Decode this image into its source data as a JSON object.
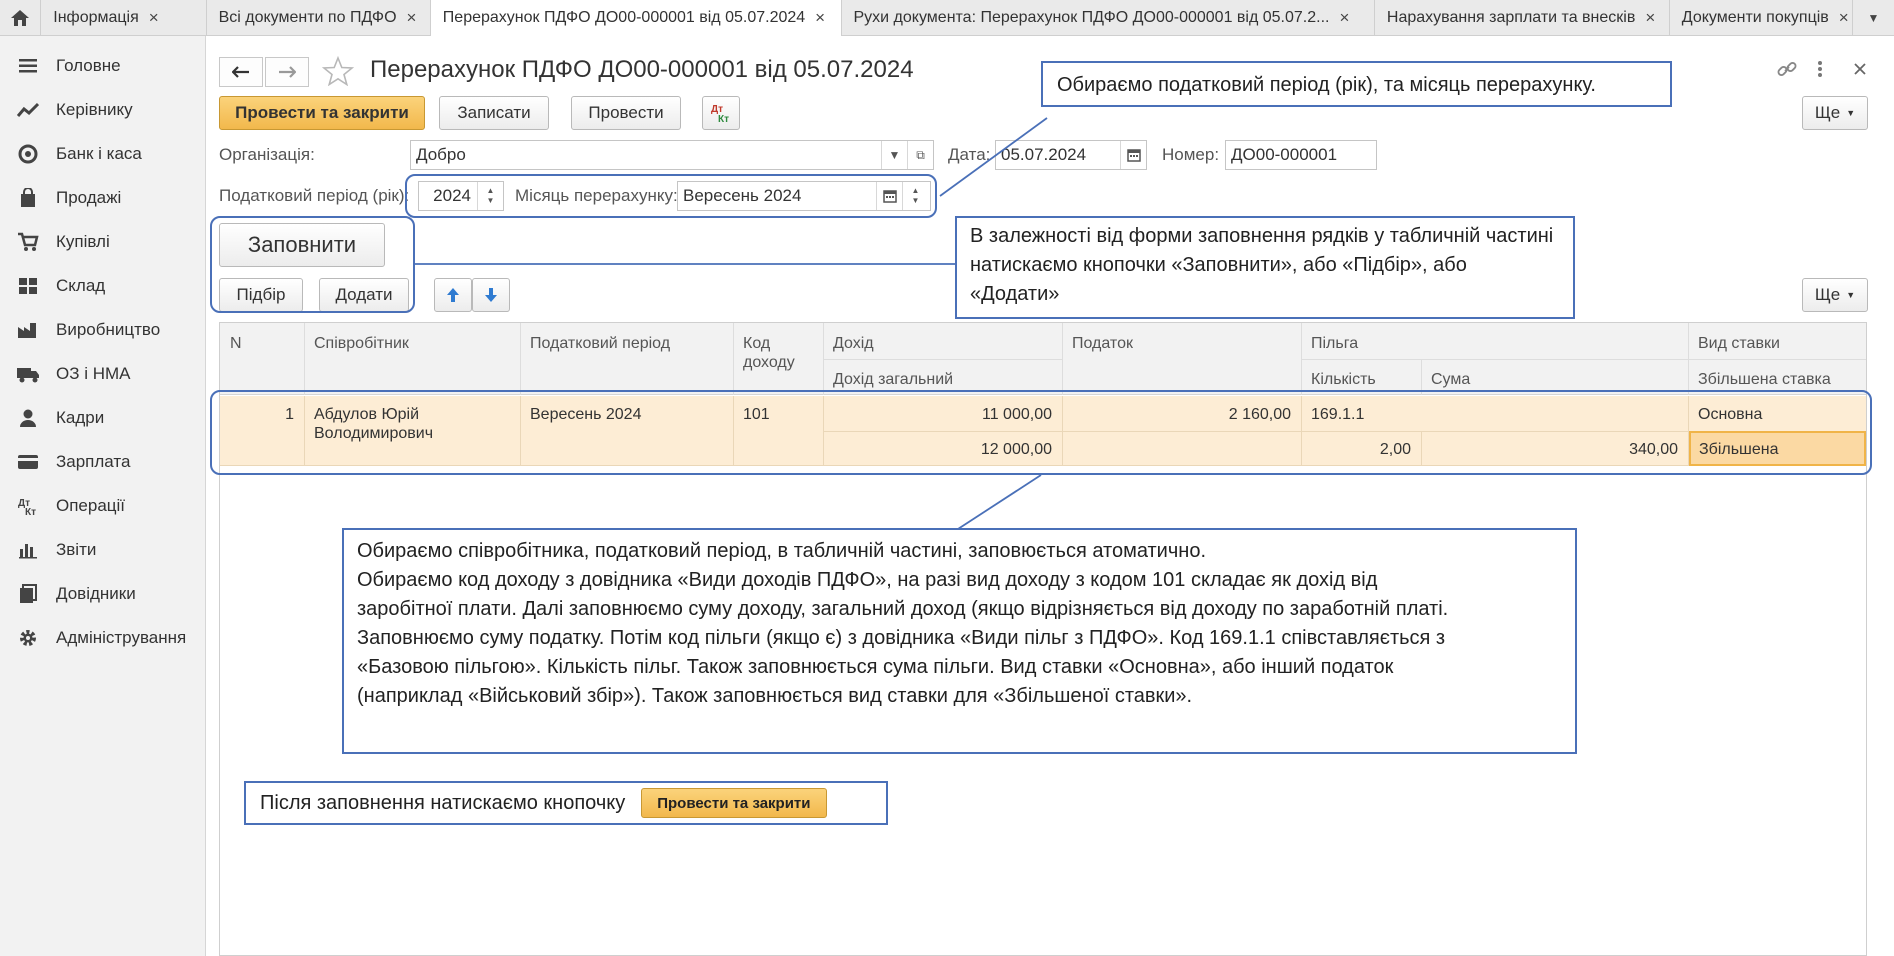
{
  "tabs": [
    {
      "label": "Інформація"
    },
    {
      "label": "Всі документи по ПДФО"
    },
    {
      "label": "Перерахунок ПДФО ДО00-000001 від 05.07.2024"
    },
    {
      "label": "Рухи документа: Перерахунок ПДФО ДО00-000001 від 05.07.2..."
    },
    {
      "label": "Нарахування зарплати та внесків"
    },
    {
      "label": "Документи покупців"
    }
  ],
  "sidebar": {
    "items": [
      {
        "label": "Головне",
        "icon": "menu-icon"
      },
      {
        "label": "Керівнику",
        "icon": "trend-icon"
      },
      {
        "label": "Банк і каса",
        "icon": "coins-icon"
      },
      {
        "label": "Продажі",
        "icon": "bag-icon"
      },
      {
        "label": "Купівлі",
        "icon": "cart-icon"
      },
      {
        "label": "Склад",
        "icon": "grid-icon"
      },
      {
        "label": "Виробництво",
        "icon": "factory-icon"
      },
      {
        "label": "ОЗ і НМА",
        "icon": "truck-icon"
      },
      {
        "label": "Кадри",
        "icon": "person-icon"
      },
      {
        "label": "Зарплата",
        "icon": "card-icon"
      },
      {
        "label": "Операції",
        "icon": "dt-kt-icon"
      },
      {
        "label": "Звіти",
        "icon": "bar-chart-icon"
      },
      {
        "label": "Довідники",
        "icon": "books-icon"
      },
      {
        "label": "Адміністрування",
        "icon": "gear-icon"
      }
    ]
  },
  "document": {
    "title": "Перерахунок ПДФО ДО00-000001 від 05.07.2024"
  },
  "toolbar": {
    "post_close": "Провести та закрити",
    "save": "Записати",
    "post": "Провести",
    "more": "Ще"
  },
  "form": {
    "org_label": "Організація:",
    "org_value": "Добро",
    "date_label": "Дата:",
    "date_value": "05.07.2024",
    "number_label": "Номер:",
    "number_value": "ДО00-000001",
    "tax_period_label": "Податковий період (рік):",
    "tax_period_value": "2024",
    "month_label": "Місяць перерахунку:",
    "month_value": "Вересень 2024"
  },
  "table_toolbar": {
    "fill": "Заповнити",
    "pick": "Підбір",
    "add": "Додати",
    "more": "Ще"
  },
  "table": {
    "headers": {
      "n": "N",
      "employee": "Співробітник",
      "period": "Податковий період",
      "code": "Код доходу",
      "income": "Дохід",
      "income_total": "Дохід загальний",
      "tax": "Податок",
      "benefit": "Пільга",
      "benefit_qty": "Кількість",
      "benefit_sum": "Сума",
      "rate": "Вид ставки",
      "rate_increased": "Збільшена ставка"
    },
    "rows": [
      {
        "n": "1",
        "employee_line1": "Абдулов Юрій",
        "employee_line2": "Володимирович",
        "period": "Вересень 2024",
        "code": "101",
        "income": "11 000,00",
        "income_total": "12 000,00",
        "tax": "2 160,00",
        "benefit": "169.1.1",
        "benefit_qty": "2,00",
        "benefit_sum": "340,00",
        "rate": "Основна",
        "rate_increased": "Збільшена"
      }
    ]
  },
  "callouts": {
    "period": "Обираємо податковий період (рік), та місяць перерахунку.",
    "fill": "В залежності від форми заповнення рядків у табличній частині натискаємо кнопочки «Заповнити», або «Підбір», або «Додати»",
    "table_lines": [
      "Обираємо співробітника, податковий період, в табличній частині, заповюється атоматично.",
      "Обираємо код доходу з довідника «Види доходів ПДФО», на разі вид доходу з кодом 101 складає як дохід від",
      "заробітної плати. Далі заповнюємо суму доходу, загальний доход (якщо відрізняється від доходу по заработній платі.",
      "Заповнюємо суму податку. Потім код пільги (якщо є) з довідника «Види пільг з ПДФО». Код 169.1.1 співставляється з",
      "«Базовою пільгою». Кількість пільг. Також заповнюється сума пільги. Вид ставки «Основна», або інший податок",
      "(наприклад «Військовий збір»). Також заповнюється вид ставки для «Збільшеної ставки»."
    ],
    "final_text": "Після заповнення натискаємо кнопочку",
    "final_button": "Провести та закрити"
  },
  "colors": {
    "accent_button": "#f2b84c",
    "callout_border": "#4a70b8",
    "row_highlight": "#fdedd5"
  }
}
